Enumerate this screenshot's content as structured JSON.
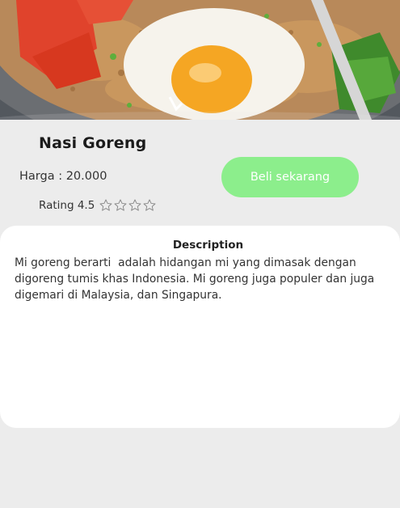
{
  "product": {
    "image": "nasi-goreng-photo",
    "title": "Nasi Goreng",
    "price_label": "Harga : 20.000",
    "rating_label": "Rating 4.5",
    "rating_value": 4.5,
    "rating_max": 5,
    "buy_label": "Beli sekarang"
  },
  "description": {
    "heading": "Description",
    "body": "Mi goreng berarti  adalah hidangan mi yang dimasak dengan digoreng tumis khas Indonesia. Mi goreng juga populer dan juga digemari di Malaysia, dan Singapura."
  },
  "colors": {
    "accent": "#8cee8c",
    "background": "#ececec",
    "card": "#ffffff"
  },
  "icons": [
    "star-outline-icon"
  ]
}
